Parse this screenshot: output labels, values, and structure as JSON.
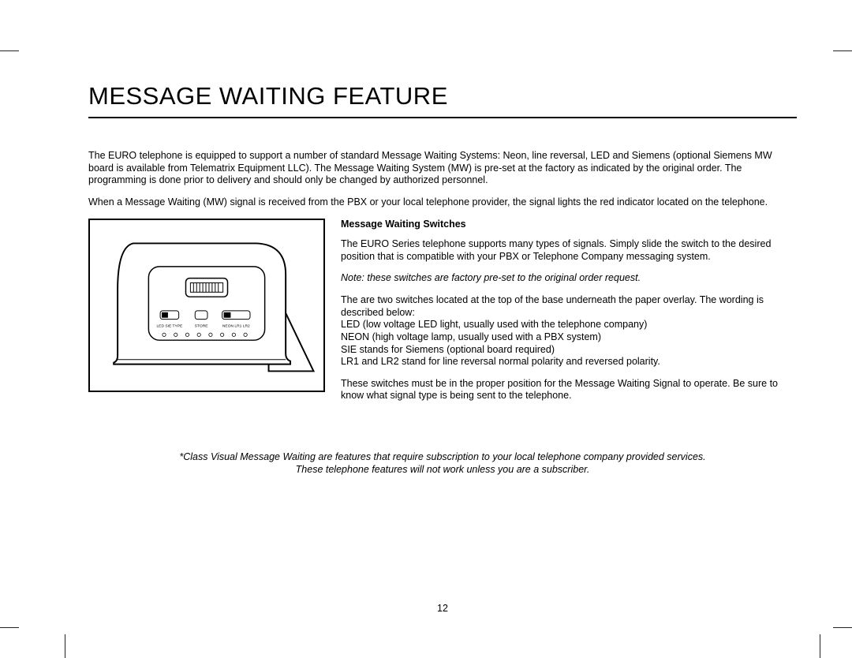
{
  "title": "MESSAGE WAITING FEATURE",
  "intro": {
    "p1": "The EURO telephone is equipped to support a number of standard Message Waiting Systems: Neon, line reversal, LED and Siemens (optional Siemens MW board is available from Telematrix Equipment LLC). The Message Waiting System (MW) is pre-set at the factory as indicated by the original order. The programming is done prior to delivery and should only be changed by authorized personnel.",
    "p2": "When a Message Waiting (MW) signal is received from the PBX or your local telephone provider, the signal lights the red indicator located on the telephone."
  },
  "switches": {
    "heading": "Message Waiting Switches",
    "p1": "The EURO Series telephone supports many types of signals. Simply slide the switch to the desired position that is compatible with your PBX or Telephone Company messaging system.",
    "note": "Note:  these switches are factory pre-set to the original order request.",
    "p2a": "The are two switches located at the top of the base underneath the paper overlay. The wording is described below:",
    "defs": {
      "led": "LED (low voltage LED light, usually used with the telephone company)",
      "neon": "NEON (high voltage lamp, usually used with a PBX system)",
      "sie": "SIE stands for Siemens (optional board required)",
      "lr": "LR1 and LR2 stand for line reversal normal polarity and reversed polarity."
    },
    "p3": "These switches must be in the proper position for the Message Waiting Signal to operate. Be sure to know what signal type is being sent to the telephone."
  },
  "diagram_labels": {
    "left": "LED SIE TYPE",
    "mid": "STORE",
    "right": "NEON LR1 LR2"
  },
  "footnote": {
    "l1": "*Class Visual Message Waiting are features that require subscription to your local telephone company provided services.",
    "l2": "These telephone features will not work unless you are a subscriber."
  },
  "page_number": "12"
}
